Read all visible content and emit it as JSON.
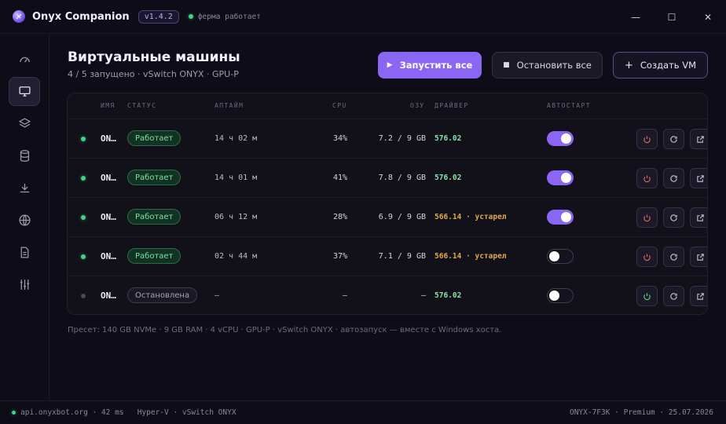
{
  "app": {
    "title": "Onyx Companion",
    "version": "v1.4.2",
    "farm_status": "ферма работает"
  },
  "window_controls": {
    "minimize": "—",
    "maximize": "☐",
    "close": "✕"
  },
  "sidebar": {
    "items": [
      {
        "icon": "speedometer-icon"
      },
      {
        "icon": "monitor-icon",
        "active": true
      },
      {
        "icon": "layers-icon"
      },
      {
        "icon": "database-icon"
      },
      {
        "icon": "download-icon"
      },
      {
        "icon": "globe-icon"
      },
      {
        "icon": "document-icon"
      },
      {
        "icon": "sliders-icon"
      }
    ]
  },
  "header": {
    "title": "Виртуальные машины",
    "subtitle": "4 / 5 запущено · vSwitch ONYX · GPU-P",
    "start_all": "Запустить все",
    "stop_all": "Остановить все",
    "create_vm": "Создать VM"
  },
  "table": {
    "columns": {
      "name": "ИМЯ",
      "status": "СТАТУС",
      "uptime": "АПТАЙМ",
      "cpu": "CPU",
      "ram": "ОЗУ",
      "driver": "ДРАЙВЕР",
      "autostart": "АВТОСТАРТ"
    },
    "rows": [
      {
        "name": "ON…",
        "status": "Работает",
        "running": true,
        "uptime": "14 ч 02 м",
        "cpu": "34%",
        "ram": "7.2 / 9 GB",
        "driver": "576.02",
        "driver_outdated": false,
        "autostart": true
      },
      {
        "name": "ON…",
        "status": "Работает",
        "running": true,
        "uptime": "14 ч 01 м",
        "cpu": "41%",
        "ram": "7.8 / 9 GB",
        "driver": "576.02",
        "driver_outdated": false,
        "autostart": true
      },
      {
        "name": "ON…",
        "status": "Работает",
        "running": true,
        "uptime": "06 ч 12 м",
        "cpu": "28%",
        "ram": "6.9 / 9 GB",
        "driver": "566.14 · устарел",
        "driver_outdated": true,
        "autostart": true
      },
      {
        "name": "ON…",
        "status": "Работает",
        "running": true,
        "uptime": "02 ч 44 м",
        "cpu": "37%",
        "ram": "7.1 / 9 GB",
        "driver": "566.14 · устарел",
        "driver_outdated": true,
        "autostart": false
      },
      {
        "name": "ON…",
        "status": "Остановлена",
        "running": false,
        "uptime": "—",
        "cpu": "—",
        "ram": "—",
        "driver": "576.02",
        "driver_outdated": false,
        "autostart": false
      }
    ]
  },
  "preset_note": "Пресет: 140 GB NVMe · 9 GB RAM · 4 vCPU · GPU-P · vSwitch ONYX · автозапуск — вместе с Windows хоста.",
  "statusbar": {
    "left": "api.onyxbot.org · 42 ms   Hyper-V · vSwitch ONYX",
    "right": "ONYX-7F3K · Premium · 25.07.2026"
  },
  "colors": {
    "accent": "#8b66f5",
    "running": "#45d483",
    "outdated": "#e0a94b"
  }
}
